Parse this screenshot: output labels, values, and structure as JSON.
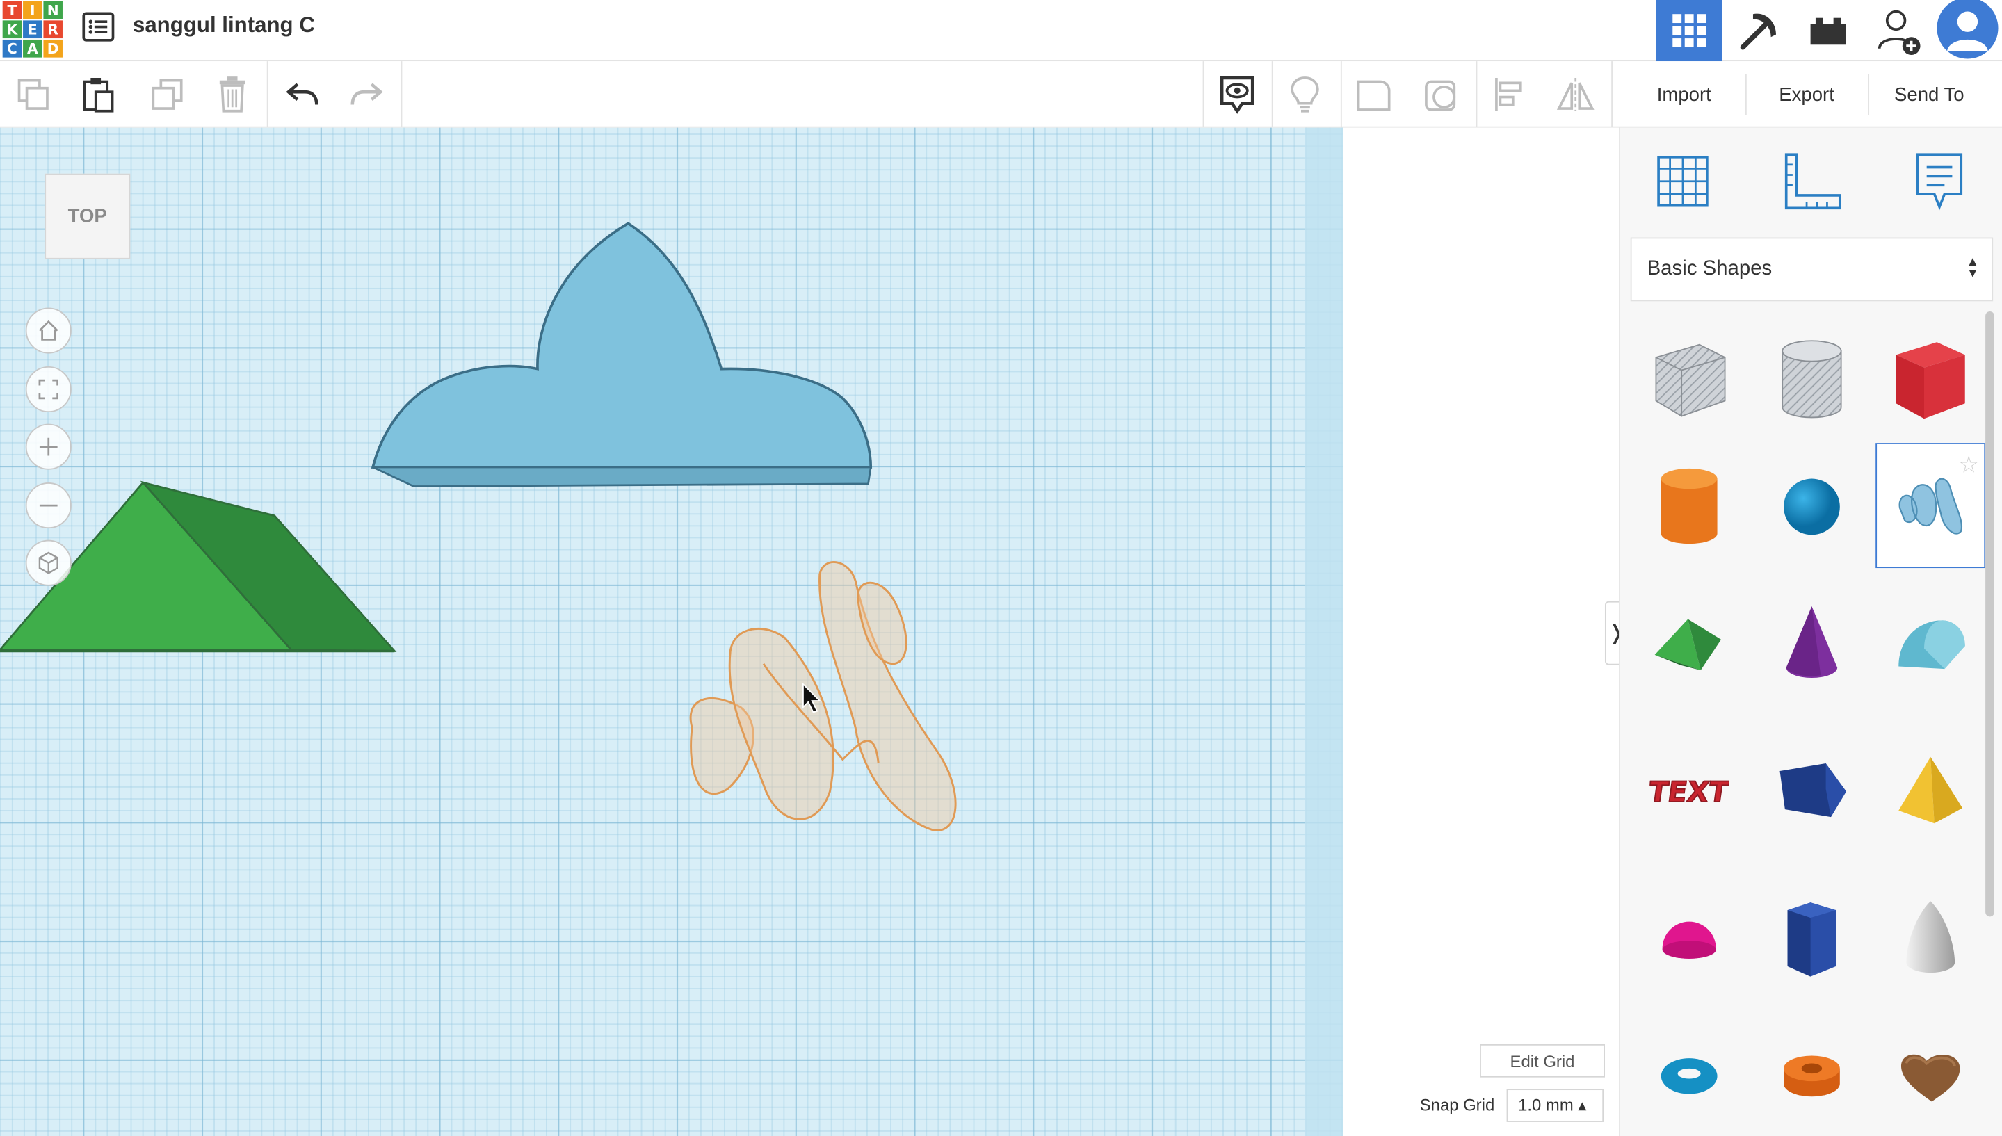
{
  "header": {
    "logo_letters": [
      "T",
      "I",
      "N",
      "K",
      "E",
      "R",
      "C",
      "A",
      "D"
    ],
    "logo_colors": [
      "#e8482f",
      "#f3a41b",
      "#3fa64b",
      "#3fa64b",
      "#2e79c6",
      "#e8482f",
      "#2e79c6",
      "#3fa64b",
      "#f3a41b"
    ],
    "document_title": "sanggul lintang C",
    "accent_color": "#3e7bd4",
    "right_icons": [
      "3d-design-grid-icon",
      "pickaxe-icon",
      "bricks-icon",
      "add-user-icon",
      "user-avatar-icon"
    ]
  },
  "toolbar": {
    "left_icons": [
      "copy-icon",
      "paste-icon",
      "duplicate-icon",
      "delete-icon",
      "undo-icon",
      "redo-icon"
    ],
    "right_icons": [
      "notes-visibility-icon",
      "lightbulb-icon",
      "shape-outline-icon",
      "group-icon",
      "align-icon",
      "mirror-icon"
    ],
    "import_label": "Import",
    "export_label": "Export",
    "send_to_label": "Send To"
  },
  "workplane": {
    "viewcube_label": "TOP",
    "nav_buttons": [
      "home-view-icon",
      "fit-view-icon",
      "zoom-in-icon",
      "zoom-out-icon",
      "perspective-icon"
    ],
    "grid_color": "#d8eef7",
    "edit_grid_label": "Edit Grid",
    "snap_grid_label": "Snap Grid",
    "snap_grid_value": "1.0 mm ▴"
  },
  "panel": {
    "tools": [
      "workplane-icon",
      "ruler-icon",
      "notes-icon"
    ],
    "library_name": "Basic Shapes",
    "shapes": [
      "box-hole",
      "cylinder-hole",
      "box",
      "cylinder",
      "sphere",
      "scribble",
      "roof",
      "cone",
      "round-roof",
      "text",
      "wedge",
      "pyramid",
      "half-sphere",
      "polygon",
      "paraboloid",
      "torus",
      "tube",
      "heart"
    ]
  },
  "scene_objects": [
    "green-roof-shape",
    "blue-cloud-shape",
    "orange-scribble-hole"
  ]
}
